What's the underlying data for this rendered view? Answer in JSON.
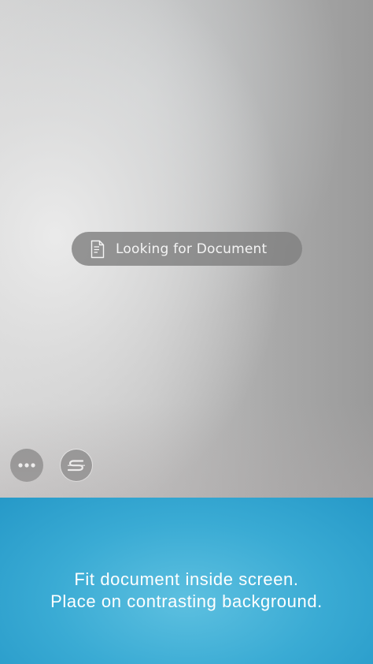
{
  "status": {
    "label": "Looking for Document"
  },
  "controls": {
    "more_icon": "more-horizontal-icon",
    "logo_icon": "scansnap-logo-icon"
  },
  "instructions": {
    "line1": "Fit document inside screen.",
    "line2": "Place on contrasting background."
  },
  "colors": {
    "panel_blue": "#3aabd4",
    "pill_gray": "#808080",
    "text_white": "#ffffff"
  }
}
